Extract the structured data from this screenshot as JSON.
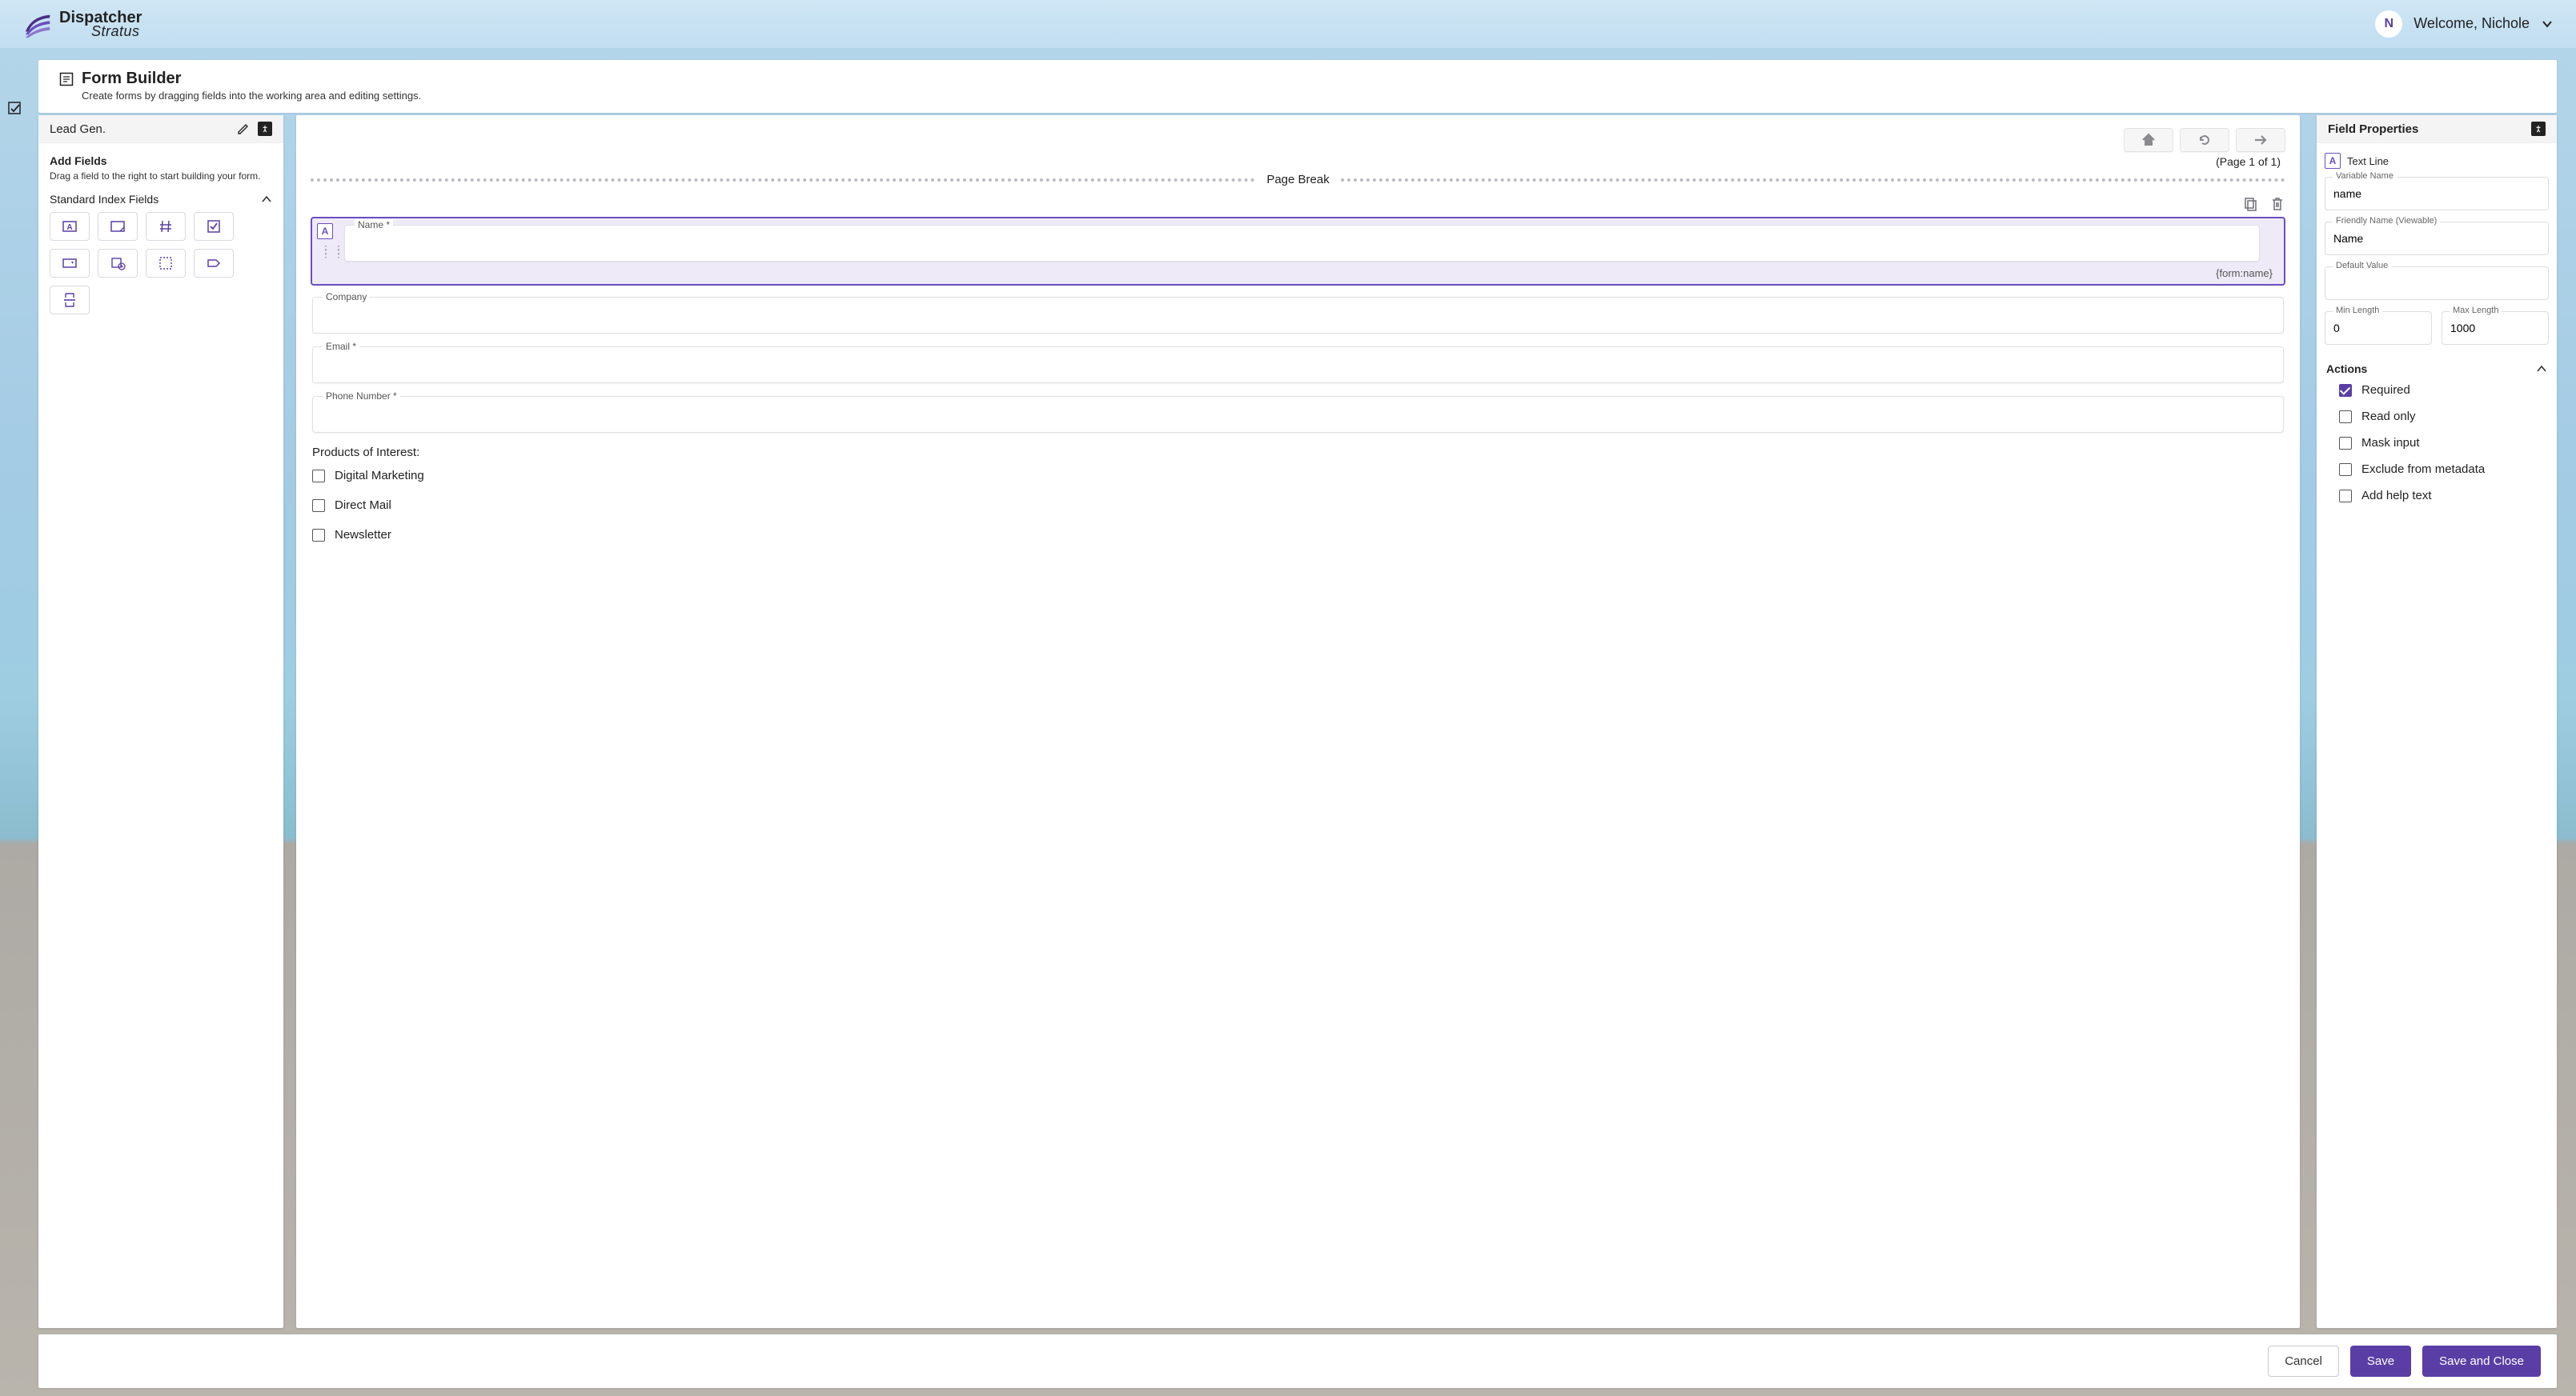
{
  "brand": {
    "name1": "Dispatcher",
    "name2": "Stratus"
  },
  "user": {
    "initial": "N",
    "welcome": "Welcome, Nichole"
  },
  "pageHeader": {
    "title": "Form Builder",
    "subtitle": "Create forms by dragging fields into the working area and editing settings."
  },
  "leftPanel": {
    "title": "Lead Gen.",
    "addFields": "Add Fields",
    "hint": "Drag a field to the right to start building your form.",
    "stdFieldsLabel": "Standard Index Fields",
    "tiles": [
      {
        "name": "text-line-icon"
      },
      {
        "name": "text-area-icon"
      },
      {
        "name": "number-icon"
      },
      {
        "name": "checkbox-icon"
      },
      {
        "name": "dropdown-icon"
      },
      {
        "name": "date-icon"
      },
      {
        "name": "group-icon"
      },
      {
        "name": "label-icon"
      },
      {
        "name": "page-break-icon"
      }
    ]
  },
  "center": {
    "pageOf": "(Page 1 of 1)",
    "pageBreak": "Page Break",
    "selected": {
      "label": "Name *",
      "binding": "{form:name}"
    },
    "fields": [
      {
        "label": "Company"
      },
      {
        "label": "Email *"
      },
      {
        "label": "Phone Number *"
      }
    ],
    "sectionLabel": "Products of Interest:",
    "checks": [
      "Digital Marketing",
      "Direct Mail",
      "Newsletter"
    ]
  },
  "rightPanel": {
    "header": "Field Properties",
    "typeName": "Text Line",
    "labels": {
      "varName": "Variable Name",
      "friendly": "Friendly Name (Viewable)",
      "default": "Default Value",
      "min": "Min Length",
      "max": "Max Length",
      "actions": "Actions"
    },
    "values": {
      "varName": "name",
      "friendly": "Name",
      "default": "",
      "min": "0",
      "max": "1000"
    },
    "options": {
      "required": "Required",
      "readonly": "Read only",
      "mask": "Mask input",
      "exclude": "Exclude from metadata",
      "help": "Add help text"
    }
  },
  "footer": {
    "cancel": "Cancel",
    "save": "Save",
    "saveClose": "Save and Close"
  }
}
